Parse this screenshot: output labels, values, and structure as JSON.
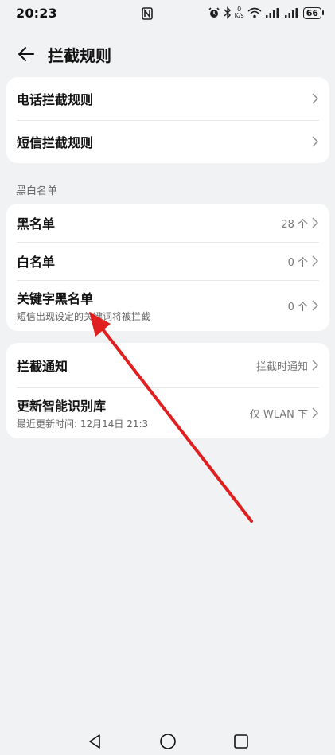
{
  "status_bar": {
    "time": "20:23",
    "net_speed_top": "0",
    "net_speed_unit": "K/s",
    "battery": "66",
    "icons": [
      "nfc-icon",
      "alarm-icon",
      "bluetooth-icon",
      "wifi-icon",
      "signal-icon",
      "signal-icon",
      "battery-icon"
    ]
  },
  "header": {
    "title": "拦截规则",
    "back_icon": "arrow-left-icon"
  },
  "card1": {
    "rows": [
      {
        "label": "电话拦截规则"
      },
      {
        "label": "短信拦截规则"
      }
    ]
  },
  "section_blacklist": {
    "label": "黑白名单"
  },
  "card2": {
    "rows": [
      {
        "label": "黑名单",
        "value": "28 个"
      },
      {
        "label": "白名单",
        "value": "0 个"
      },
      {
        "label": "关键字黑名单",
        "sub": "短信出现设定的关键词将被拦截",
        "value": "0 个"
      }
    ]
  },
  "card3": {
    "rows": [
      {
        "label": "拦截通知",
        "value": "拦截时通知"
      },
      {
        "label": "更新智能识别库",
        "sub": "最近更新时间: 12月14日 21:3",
        "value": "仅 WLAN 下"
      }
    ]
  },
  "nav": {
    "icons": [
      "back-triangle-icon",
      "home-circle-icon",
      "recents-square-icon"
    ]
  },
  "annotation": {
    "color": "#e02020"
  }
}
